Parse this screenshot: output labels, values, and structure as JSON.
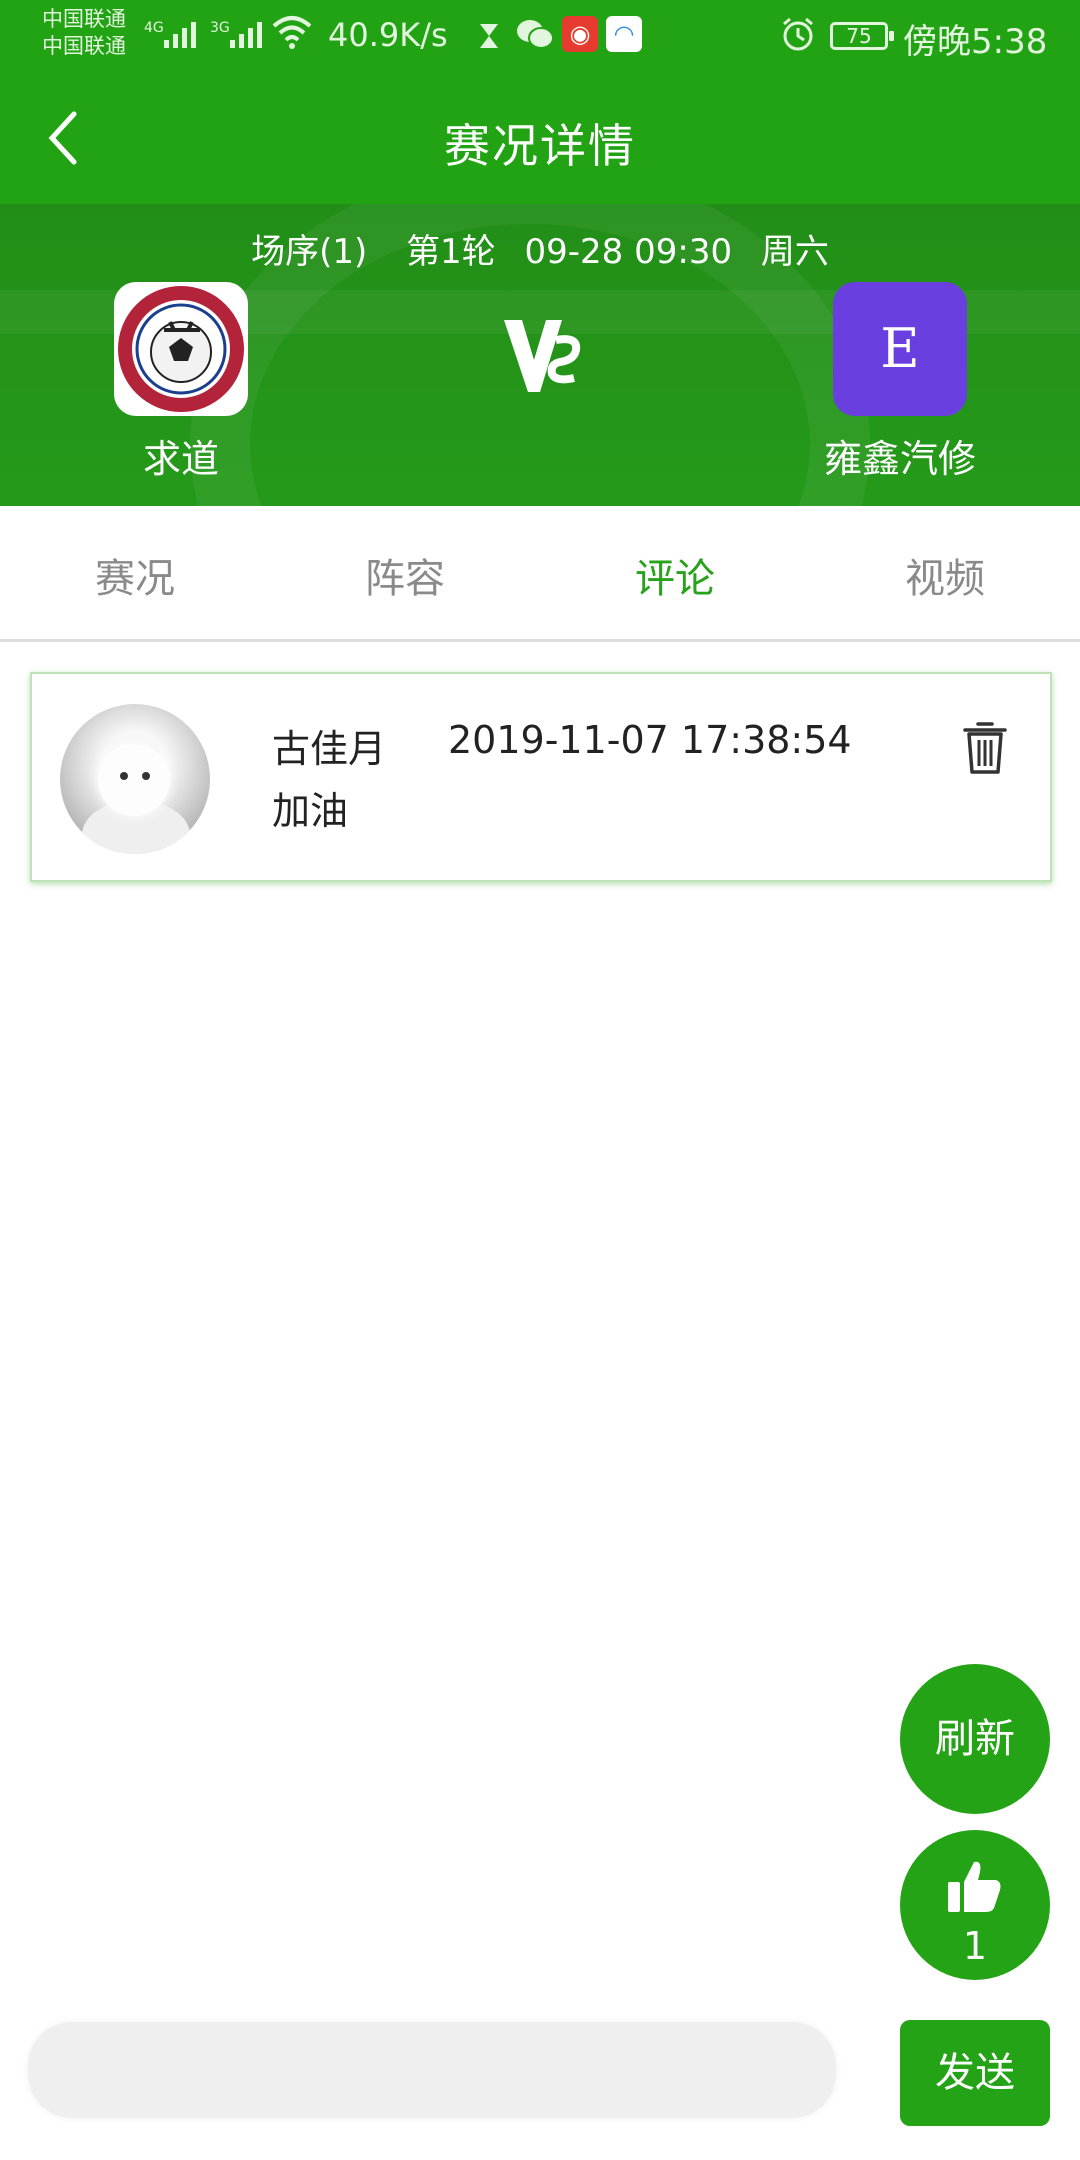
{
  "status_bar": {
    "carrier_1": "中国联通",
    "carrier_2": "中国联通",
    "net_1": "4G",
    "net_2": "3G",
    "speed": "40.9K/s",
    "battery": "75",
    "time": "傍晚5:38"
  },
  "header": {
    "title": "赛况详情"
  },
  "match": {
    "order": "场序(1)",
    "round": "第1轮",
    "datetime": "09-28 09:30",
    "weekday": "周六",
    "home_team": "求道",
    "away_team": "雍鑫汽修",
    "away_logo_letter": "E",
    "vs_text": "VS"
  },
  "tabs": [
    {
      "label": "赛况"
    },
    {
      "label": "阵容"
    },
    {
      "label": "评论"
    },
    {
      "label": "视频"
    }
  ],
  "active_tab": "评论",
  "comments": [
    {
      "author": "古佳月",
      "time": "2019-11-07 17:38:54",
      "content": "加油"
    }
  ],
  "actions": {
    "refresh_label": "刷新",
    "like_count": "1",
    "send_label": "发送"
  },
  "comment_input": {
    "value": "",
    "placeholder": ""
  },
  "colors": {
    "brand_green": "#22a313",
    "active_tab": "#27a21a",
    "away_logo": "#6a3fe0"
  }
}
